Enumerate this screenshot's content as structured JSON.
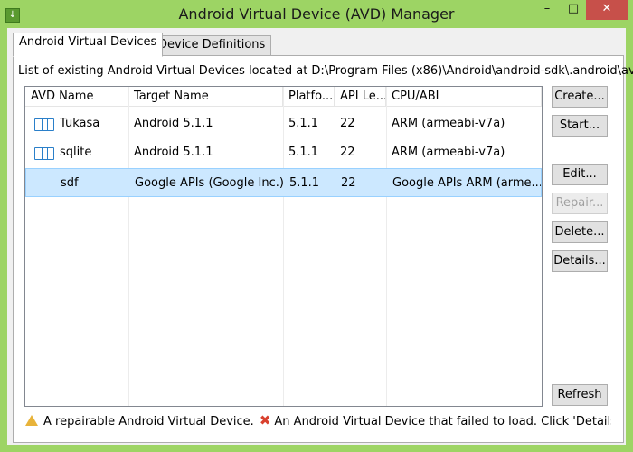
{
  "window": {
    "title": "Android Virtual Device (AVD) Manager",
    "min_glyph": "–",
    "max_glyph": "□",
    "close_glyph": "✕",
    "sys_glyph": "↓"
  },
  "tabs": [
    {
      "label": "Android Virtual Devices",
      "active": true
    },
    {
      "label": "Device Definitions",
      "active": false
    }
  ],
  "path_label": "List of existing Android Virtual Devices located at D:\\Program Files (x86)\\Android\\android-sdk\\.android\\avd",
  "table": {
    "columns": [
      "AVD Name",
      "Target Name",
      "Platfo...",
      "API Le...",
      "CPU/ABI"
    ],
    "rows": [
      {
        "name": "Tukasa",
        "target": "Android 5.1.1",
        "platform": "5.1.1",
        "api": "22",
        "cpu": "ARM (armeabi-v7a)",
        "icon": "device-icon",
        "selected": false
      },
      {
        "name": "sqlite",
        "target": "Android 5.1.1",
        "platform": "5.1.1",
        "api": "22",
        "cpu": "ARM (armeabi-v7a)",
        "icon": "device-icon",
        "selected": false
      },
      {
        "name": "sdf",
        "target": "Google APIs (Google Inc.)",
        "platform": "5.1.1",
        "api": "22",
        "cpu": "Google APIs ARM (arme...",
        "icon": "",
        "selected": true
      }
    ]
  },
  "buttons": {
    "create": "Create...",
    "start": "Start...",
    "edit": "Edit...",
    "repair": "Repair...",
    "delete": "Delete...",
    "details": "Details...",
    "refresh": "Refresh"
  },
  "legend": {
    "repairable": "A repairable Android Virtual Device.",
    "failed": "An Android Virtual Device that failed to load. Click 'Details' to see tl"
  },
  "colors": {
    "titlebar": "#9dd464",
    "close": "#c7504a",
    "selection": "#cce8ff",
    "warning": "#e8b33a",
    "error": "#d9412e"
  }
}
